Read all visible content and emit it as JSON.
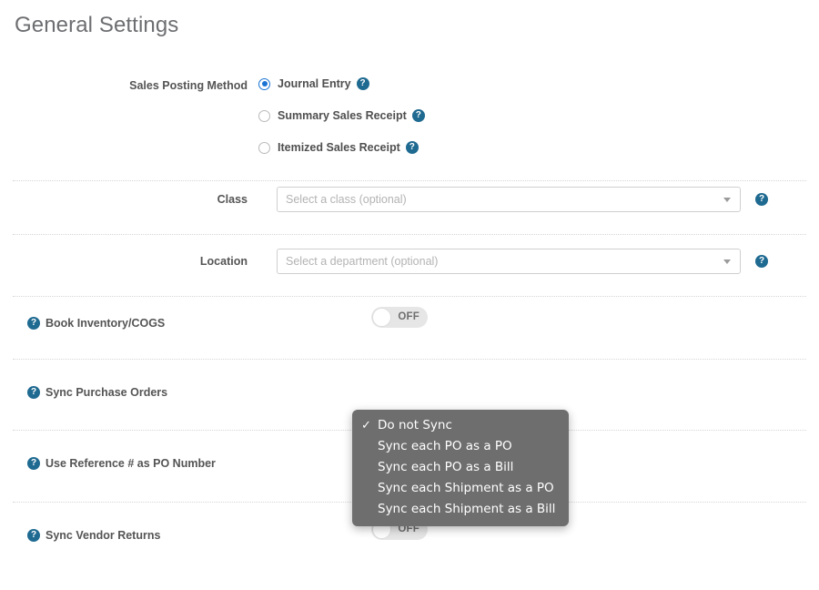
{
  "page": {
    "title": "General Settings"
  },
  "icons": {
    "help": "?",
    "check": "✓"
  },
  "colors": {
    "help_icon_blue": "#1f6a91",
    "radio_blue": "#1a73d4",
    "popup_background": "#6e6e6e",
    "toggle_track": "#e6e6e6",
    "title_gray": "#6d6e71"
  },
  "sales_posting_method": {
    "label": "Sales Posting Method",
    "options": [
      {
        "label": "Journal Entry",
        "selected": true
      },
      {
        "label": "Summary Sales Receipt",
        "selected": false
      },
      {
        "label": "Itemized Sales Receipt",
        "selected": false
      }
    ]
  },
  "class_field": {
    "label": "Class",
    "value": "",
    "placeholder": "Select a class (optional)"
  },
  "location_field": {
    "label": "Location",
    "value": "",
    "placeholder": "Select a department (optional)"
  },
  "book_inventory": {
    "label": "Book Inventory/COGS",
    "toggle_state": "OFF"
  },
  "sync_purchase_orders": {
    "label": "Sync Purchase Orders"
  },
  "use_reference_number": {
    "label": "Use Reference # as PO Number"
  },
  "sync_vendor_returns": {
    "label": "Sync Vendor Returns",
    "toggle_state": "OFF"
  },
  "sync_po_popup": {
    "selected": "Do not Sync",
    "items": [
      {
        "label": "Do not Sync",
        "checked": true
      },
      {
        "label": "Sync each PO as a PO",
        "checked": false
      },
      {
        "label": "Sync each PO as a Bill",
        "checked": false
      },
      {
        "label": "Sync each Shipment as a PO",
        "checked": false
      },
      {
        "label": "Sync each Shipment as a Bill",
        "checked": false
      }
    ]
  }
}
